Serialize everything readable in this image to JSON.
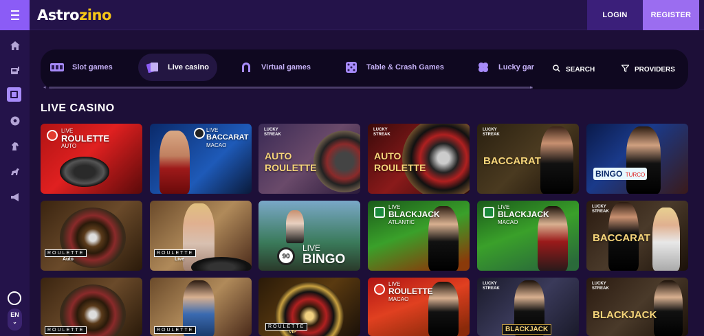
{
  "header": {
    "logo_main": "Astro",
    "logo_accent": "zino",
    "login": "LOGIN",
    "register": "REGISTER"
  },
  "sidebar": {
    "items": [
      {
        "icon": "home-icon"
      },
      {
        "icon": "slot-machine-icon"
      },
      {
        "icon": "live-casino-icon"
      },
      {
        "icon": "soccer-ball-icon"
      },
      {
        "icon": "horse-icon"
      },
      {
        "icon": "greyhound-icon"
      },
      {
        "icon": "megaphone-icon"
      }
    ],
    "support_icon": "headset-icon",
    "language": "EN"
  },
  "categories": {
    "items": [
      {
        "label": "Slot games",
        "icon": "slot-icon"
      },
      {
        "label": "Live casino",
        "icon": "cards-icon"
      },
      {
        "label": "Virtual games",
        "icon": "horseshoe-icon"
      },
      {
        "label": "Table & Crash Games",
        "icon": "dice-icon"
      },
      {
        "label": "Lucky gar",
        "icon": "clover-icon"
      }
    ],
    "search": "SEARCH",
    "providers": "PROVIDERS"
  },
  "section": {
    "title": "LIVE CASINO"
  },
  "games": {
    "row1": [
      {
        "live": "LIVE",
        "title": "ROULETTE",
        "sub": "AUTO"
      },
      {
        "live": "LIVE",
        "title": "BACCARAT",
        "sub": "MACAO"
      },
      {
        "streak": "LUCKY STREAK",
        "title_line1": "AUTO",
        "title_line2": "ROULETTE"
      },
      {
        "streak": "LUCKY STREAK",
        "title_line1": "AUTO",
        "title_line2": "ROULETTE"
      },
      {
        "streak": "LUCKY STREAK",
        "title": "BACCARAT"
      },
      {
        "title": "BINGO",
        "sub": "TURCO"
      }
    ],
    "row2": [
      {
        "badge": "ROULETTE",
        "sub": "Auto"
      },
      {
        "badge": "ROULETTE",
        "sub": "Live"
      },
      {
        "ball": "90",
        "title_line1": "LIVE",
        "title_line2": "BINGO"
      },
      {
        "live": "LIVE",
        "title": "BLACKJACK",
        "sub": "ATLANTIC"
      },
      {
        "live": "LIVE",
        "title": "BLACKJACK",
        "sub": "MACAO"
      },
      {
        "streak": "LUCKY STREAK",
        "title": "BACCARAT"
      }
    ],
    "row3": [
      {
        "badge": "ROULETTE"
      },
      {
        "badge": "ROULETTE"
      },
      {
        "badge": "ROULETTE",
        "sub": "VIP"
      },
      {
        "live": "LIVE",
        "title": "ROULETTE",
        "sub": "MACAO"
      },
      {
        "streak": "LUCKY STREAK",
        "title": "BLACKJACK"
      },
      {
        "streak": "LUCKY STREAK",
        "title": "BLACKJACK"
      }
    ]
  },
  "colors": {
    "background": "#1d0f38",
    "header": "#24134a",
    "accent": "#9b6df0",
    "logo_gold": "#f5c518"
  }
}
